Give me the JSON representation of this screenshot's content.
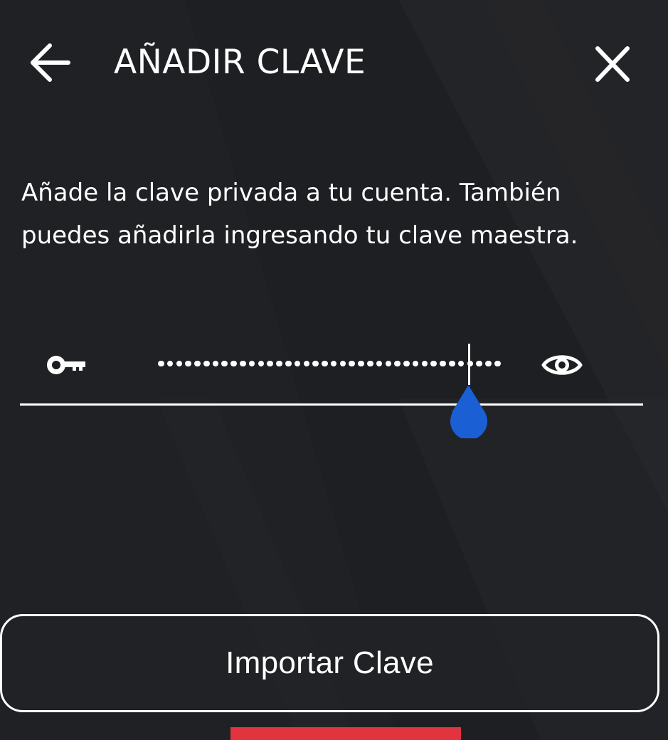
{
  "header": {
    "title": "AÑADIR CLAVE",
    "back_icon": "arrow-left-icon",
    "close_icon": "close-icon"
  },
  "description": "Añade la clave privada a tu cuenta. También puedes añadirla ingresando tu clave maestra.",
  "key_field": {
    "masked_value": "••••••••••••••••••••••••••••••••••••",
    "leading_icon": "key-icon",
    "trailing_icon": "eye-icon",
    "handle_icon": "text-selection-handle-icon"
  },
  "import_button": {
    "label": "Importar Clave"
  },
  "colors": {
    "background": "#1b1c1f",
    "accent_handle": "#1a5fd4",
    "bottom_bar": "#e1343f"
  }
}
